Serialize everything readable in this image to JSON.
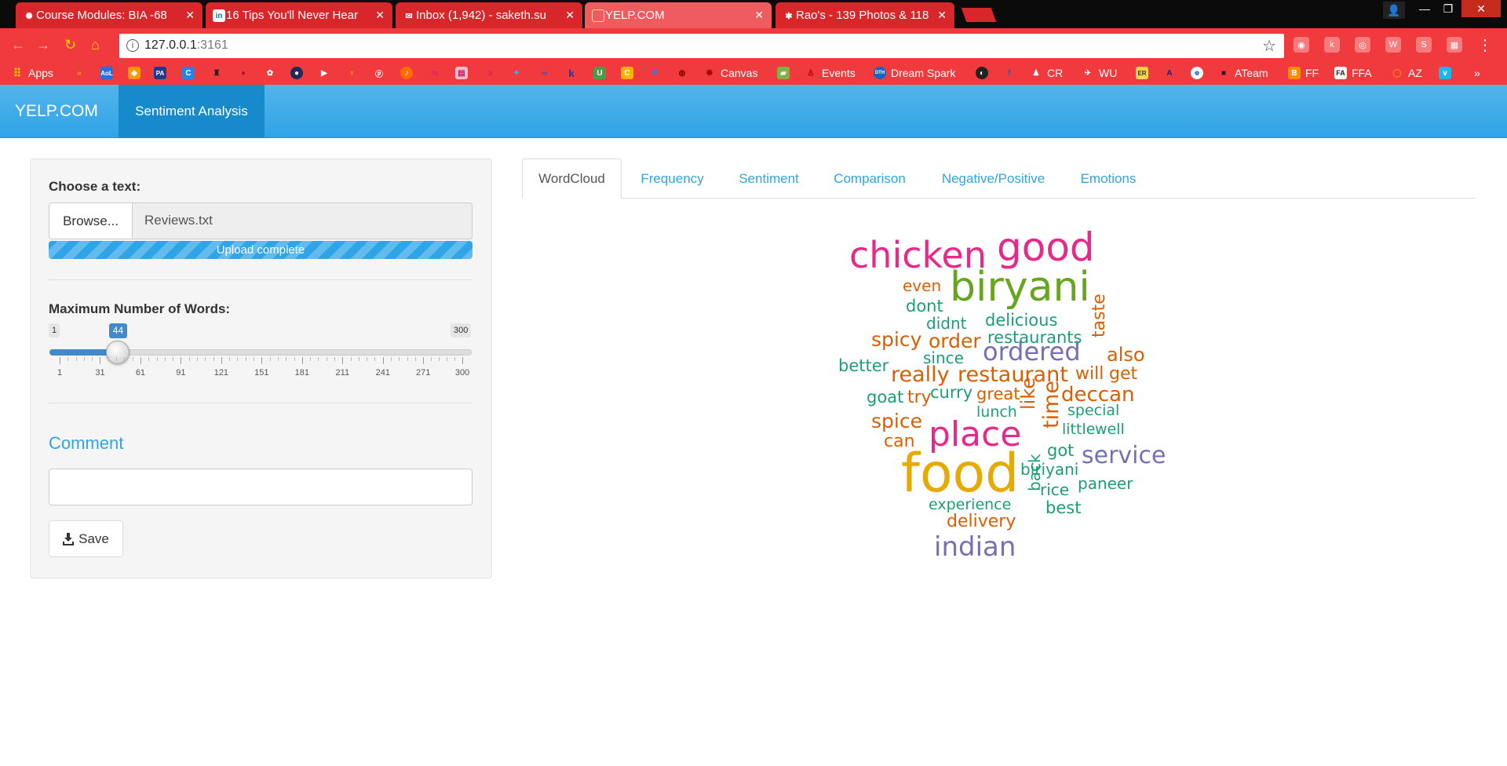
{
  "browser": {
    "tabs": [
      {
        "title": "Course Modules: BIA -68",
        "favicon": "canvas-icon",
        "active": false
      },
      {
        "title": "16 Tips You'll Never Hear",
        "favicon": "linkedin-icon",
        "active": false
      },
      {
        "title": "Inbox (1,942) - saketh.su",
        "favicon": "gmail-icon",
        "active": false
      },
      {
        "title": "YELP.COM",
        "favicon": "page-icon",
        "active": true
      },
      {
        "title": "Rao's - 139 Photos & 118",
        "favicon": "yelp-icon",
        "active": false
      }
    ],
    "url_host": "127.0.0.1",
    "url_port": ":3161",
    "bookmarks": [
      {
        "label": "Apps",
        "icon": "apps-grid-icon"
      },
      {
        "label": "Canvas",
        "icon": "canvas-icon"
      },
      {
        "label": "Events",
        "icon": "events-icon"
      },
      {
        "label": "Dream Spark",
        "icon": "dreamspark-icon"
      },
      {
        "label": "CR",
        "icon": "cr-icon"
      },
      {
        "label": "WU",
        "icon": "wu-icon"
      },
      {
        "label": "ATeam",
        "icon": "ateam-icon"
      },
      {
        "label": "FF",
        "icon": "ff-icon"
      },
      {
        "label": "FFA",
        "icon": "ffa-icon"
      },
      {
        "label": "AZ",
        "icon": "az-icon"
      }
    ],
    "bookmark_icon_labels": [
      "AoL",
      "PA",
      "C",
      "ER"
    ]
  },
  "navbar": {
    "brand": "YELP.COM",
    "active_tab": "Sentiment Analysis"
  },
  "sidebar": {
    "choose_label": "Choose a text:",
    "browse_label": "Browse...",
    "filename": "Reviews.txt",
    "upload_status": "Upload complete",
    "upload_progress_pct": 100,
    "max_words_label": "Maximum Number of Words:",
    "slider": {
      "min": 1,
      "max": 300,
      "value": 44,
      "min_label": "1",
      "max_label": "300",
      "value_label": "44",
      "tick_labels": [
        "1",
        "31",
        "61",
        "91",
        "121",
        "151",
        "181",
        "211",
        "241",
        "271",
        "300"
      ]
    },
    "comment_label": "Comment",
    "comment_value": "",
    "save_label": "Save"
  },
  "tabs": [
    "WordCloud",
    "Frequency",
    "Sentiment",
    "Comparison",
    "Negative/Positive",
    "Emotions"
  ],
  "active_tab": "WordCloud",
  "wordcloud": {
    "words": [
      "food",
      "biryani",
      "good",
      "chicken",
      "place",
      "indian",
      "ordered",
      "service",
      "restaurant",
      "really",
      "deccan",
      "spicy",
      "order",
      "spice",
      "time",
      "like",
      "taste",
      "also",
      "will",
      "get",
      "delicious",
      "restaurants",
      "delivery",
      "even",
      "dont",
      "didnt",
      "since",
      "better",
      "goat",
      "try",
      "curry",
      "great",
      "lunch",
      "can",
      "special",
      "little",
      "well",
      "got",
      "biriyani",
      "back",
      "rice",
      "paneer",
      "best",
      "experience"
    ],
    "colors": {
      "orange": "#d95f02",
      "green": "#1b9e77",
      "purple": "#7570b3",
      "magenta": "#e7298a",
      "lime": "#66a61e",
      "gold": "#e6ab02"
    }
  }
}
